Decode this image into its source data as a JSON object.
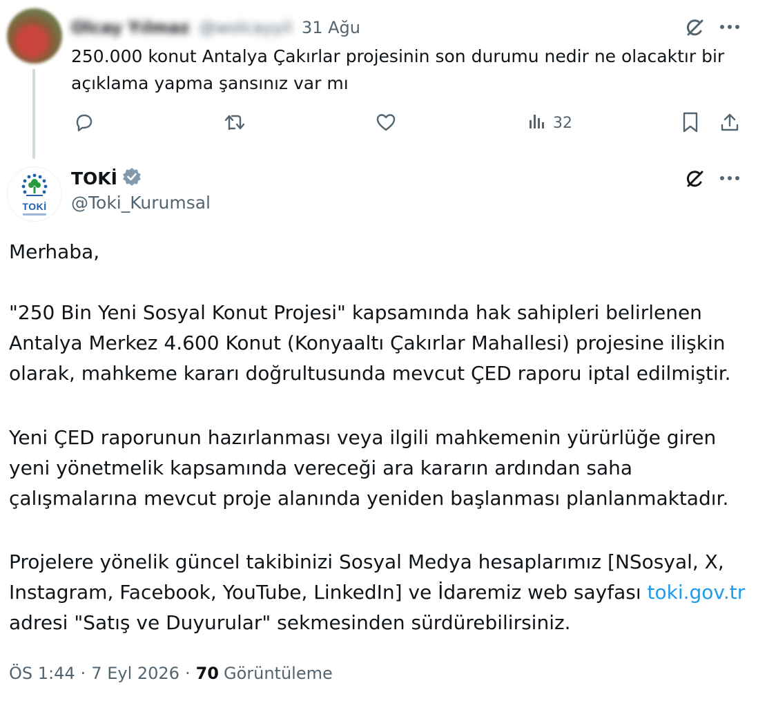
{
  "reply": {
    "author_name": "Olcay Yılmaz",
    "author_handle": "@wolcayyil",
    "date": "31 Ağu",
    "text": "250.000 konut Antalya Çakırlar projesinin son durumu nedir ne olacaktır bir açıklama yapma şansınız var mı",
    "views": "32"
  },
  "tweet": {
    "author_name": "TOKİ",
    "author_handle": "@Toki_Kurumsal",
    "avatar_text": "TOKİ",
    "paragraphs": [
      "Merhaba,",
      "\"250 Bin Yeni Sosyal Konut Projesi\" kapsamında hak sahipleri belirlenen Antalya Merkez 4.600 Konut (Konyaaltı Çakırlar Mahallesi) projesine ilişkin olarak, mahkeme kararı doğrultusunda mevcut ÇED raporu iptal edilmiştir.",
      "Yeni ÇED raporunun hazırlanması veya ilgili mahkemenin yürürlüğe giren yeni yönetmelik kapsamında vereceği ara kararın ardından saha çalışmalarına mevcut proje alanında yeniden başlanması planlanmaktadır."
    ],
    "last_paragraph_pre": "Projelere yönelik güncel takibinizi Sosyal Medya hesaplarımız [NSosyal, X, Instagram, Facebook, YouTube, LinkedIn] ve İdaremiz web sayfası ",
    "link_text": "toki.gov.tr",
    "last_paragraph_post": " adresi \"Satış ve Duyurular\" sekmesinden sürdürebilirsiniz.",
    "time": "ÖS 1:44",
    "date": "7 Eyl 2026",
    "separator": "·",
    "views_count": "70",
    "views_label": "Görüntüleme"
  },
  "icons": {
    "grok": "grok-icon",
    "more": "more-icon",
    "reply": "reply-icon",
    "retweet": "retweet-icon",
    "like": "like-icon",
    "views": "views-icon",
    "bookmark": "bookmark-icon",
    "share": "share-icon",
    "verified": "verified-badge-icon"
  },
  "colors": {
    "text": "#0f1419",
    "secondary": "#536471",
    "link": "#1d9bf0",
    "thread_line": "#cfd9de",
    "verified_badge": "#829aab"
  }
}
